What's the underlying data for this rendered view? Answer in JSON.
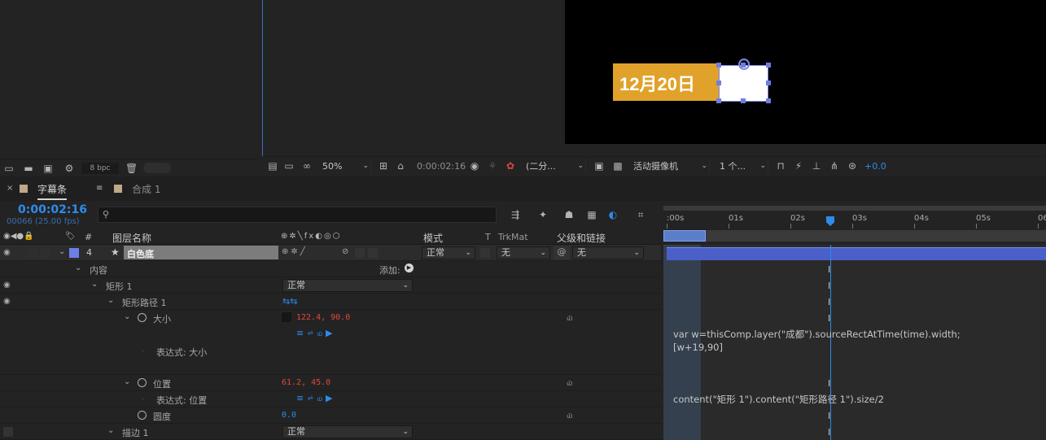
{
  "project": {
    "bpc": "8 bpc"
  },
  "viewer": {
    "title_text": "12月20日",
    "zoom": "50%",
    "timecode": "0:00:02:16",
    "resolution": "(二分...",
    "camera": "活动摄像机",
    "views": "1 个...",
    "exposure": "+0.0"
  },
  "tabs": {
    "active_label": "字幕条",
    "inactive_label": "合成 1"
  },
  "timeline": {
    "current_time": "0:00:02:16",
    "frame_info": "00066 (25.00 fps)",
    "search_placeholder": "",
    "columns": {
      "hash": "#",
      "layer_name": "图层名称",
      "mode": "模式",
      "t": "T",
      "trkmat": "TrkMat",
      "parent": "父级和链接"
    },
    "ruler_ticks": [
      ":00s",
      "01s",
      "02s",
      "03s",
      "04s",
      "05s",
      "06s"
    ],
    "layer": {
      "index": "4",
      "name": "白色底",
      "mode": "正常",
      "trkmat": "无",
      "parent": "无"
    },
    "content_label": "内容",
    "add_label": "添加:",
    "shape_label": "矩形 1",
    "shape_mode": "正常",
    "path_label": "矩形路径 1",
    "size_label": "大小",
    "size_value": "122.4, 90.0",
    "size_expr_label": "表达式: 大小",
    "size_expression": "var w=thisComp.layer(\"成都\").sourceRectAtTime(time).width;\n[w+19,90]",
    "position_label": "位置",
    "position_value": "61.2, 45.0",
    "position_expr_label": "表达式: 位置",
    "position_expression": "content(\"矩形 1\").content(\"矩形路径 1\").size/2",
    "roundness_label": "圆度",
    "roundness_value": "0.0",
    "stroke_label": "描边 1",
    "stroke_mode": "正常"
  },
  "colors": {
    "accent_blue": "#2d8ceb",
    "title_orange": "#e0a22a",
    "value_red": "#e2463b",
    "layer_bar": "#4a5fc7"
  }
}
